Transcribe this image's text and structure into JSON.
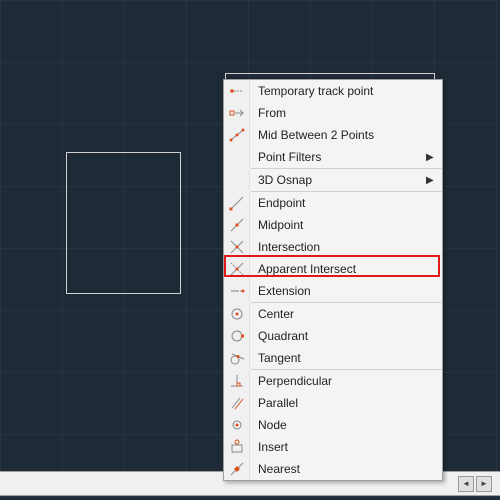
{
  "menu": {
    "groups": [
      [
        {
          "id": "temp-track",
          "label": "Temporary track point",
          "submenu": false,
          "icon": "track-point"
        },
        {
          "id": "from",
          "label": "From",
          "submenu": false,
          "icon": "from"
        },
        {
          "id": "mid-between",
          "label": "Mid Between 2 Points",
          "submenu": false,
          "icon": "mid-between"
        },
        {
          "id": "point-filters",
          "label": "Point Filters",
          "submenu": true,
          "icon": "blank"
        }
      ],
      [
        {
          "id": "3d-osnap",
          "label": "3D Osnap",
          "submenu": true,
          "icon": "blank"
        }
      ],
      [
        {
          "id": "endpoint",
          "label": "Endpoint",
          "submenu": false,
          "icon": "endpoint"
        },
        {
          "id": "midpoint",
          "label": "Midpoint",
          "submenu": false,
          "icon": "midpoint"
        },
        {
          "id": "intersection",
          "label": "Intersection",
          "submenu": false,
          "icon": "intersection",
          "highlighted": true
        },
        {
          "id": "apparent-intersect",
          "label": "Apparent Intersect",
          "submenu": false,
          "icon": "apparent"
        },
        {
          "id": "extension",
          "label": "Extension",
          "submenu": false,
          "icon": "extension"
        }
      ],
      [
        {
          "id": "center",
          "label": "Center",
          "submenu": false,
          "icon": "center"
        },
        {
          "id": "quadrant",
          "label": "Quadrant",
          "submenu": false,
          "icon": "quadrant"
        },
        {
          "id": "tangent",
          "label": "Tangent",
          "submenu": false,
          "icon": "tangent"
        }
      ],
      [
        {
          "id": "perpendicular",
          "label": "Perpendicular",
          "submenu": false,
          "icon": "perpendicular"
        },
        {
          "id": "parallel",
          "label": "Parallel",
          "submenu": false,
          "icon": "parallel"
        },
        {
          "id": "node",
          "label": "Node",
          "submenu": false,
          "icon": "node"
        },
        {
          "id": "insert",
          "label": "Insert",
          "submenu": false,
          "icon": "insert"
        },
        {
          "id": "nearest",
          "label": "Nearest",
          "submenu": false,
          "icon": "nearest"
        }
      ]
    ]
  },
  "colors": {
    "accent": "#d9541e",
    "highlight": "#e31818",
    "canvas_bg": "#1e2b36",
    "grid": "#263440",
    "wire": "#d0d0d0"
  }
}
